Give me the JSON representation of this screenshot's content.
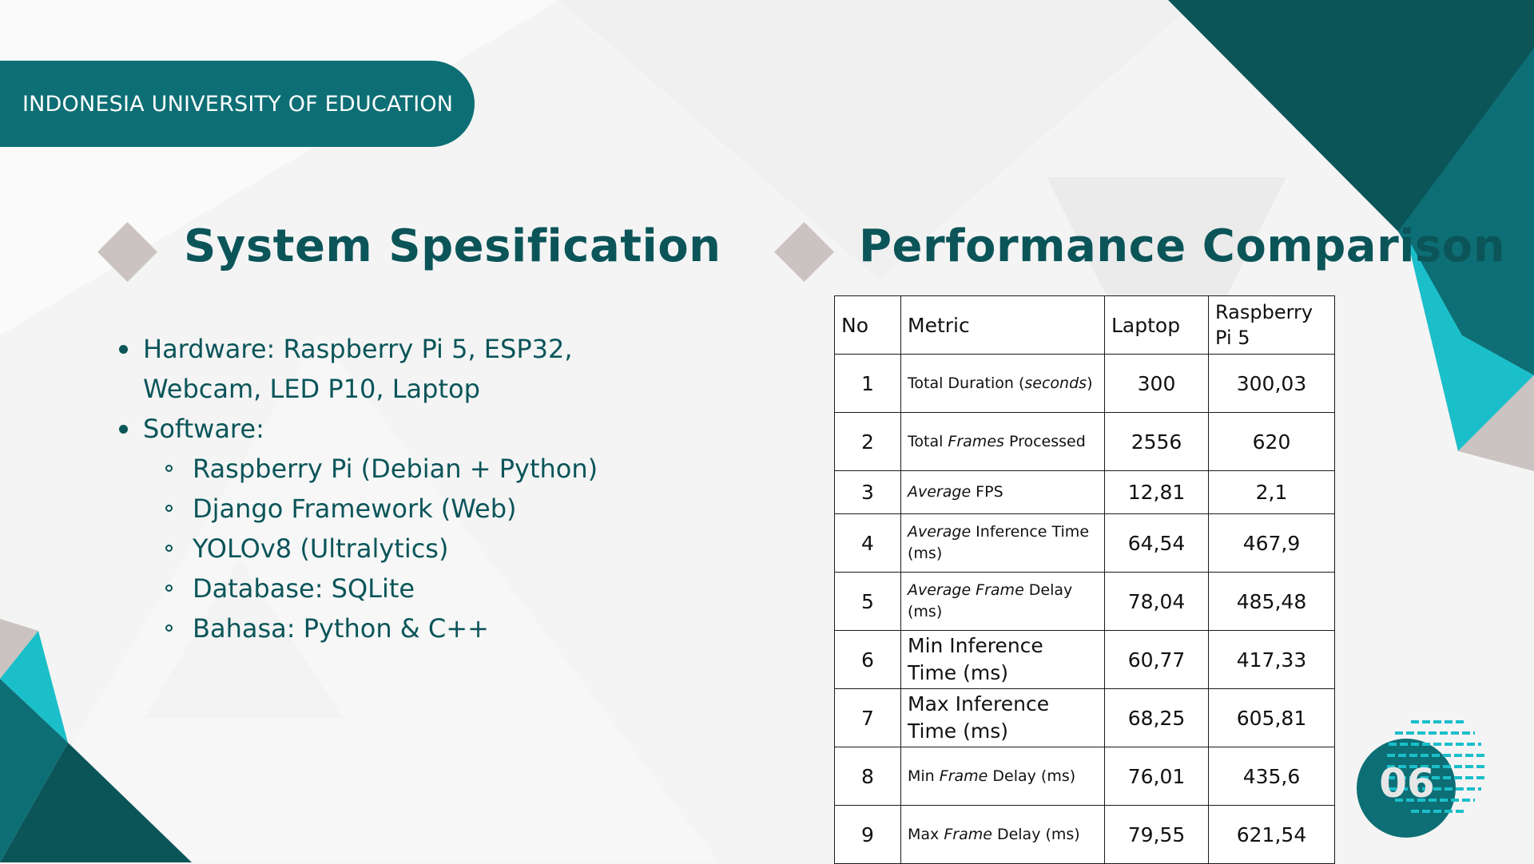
{
  "header": {
    "university": "INDONESIA UNIVERSITY OF EDUCATION"
  },
  "specification": {
    "title": "System Spesification",
    "hardware": "Hardware: Raspberry Pi 5, ESP32, Webcam, LED P10, Laptop",
    "software_label": "Software:",
    "software_items": [
      "Raspberry Pi (Debian + Python)",
      "Django Framework (Web)",
      "YOLOv8 (Ultralytics)",
      "Database: SQLite",
      "Bahasa: Python & C++"
    ]
  },
  "performance": {
    "title": "Performance Comparison",
    "columns": [
      "No",
      "Metric",
      "Laptop",
      "Raspberry Pi 5"
    ],
    "rows": [
      {
        "no": "1",
        "metric": "Total Duration (<i>seconds</i>)",
        "laptop": "300",
        "pi": "300,03",
        "large": false
      },
      {
        "no": "2",
        "metric": "Total <i>Frames</i> Processed",
        "laptop": "2556",
        "pi": "620",
        "large": false
      },
      {
        "no": "3",
        "metric": "<i>Average</i> FPS",
        "laptop": "12,81",
        "pi": "2,1",
        "large": false
      },
      {
        "no": "4",
        "metric": "<i>Average</i> Inference Time (ms)",
        "laptop": "64,54",
        "pi": "467,9",
        "large": false
      },
      {
        "no": "5",
        "metric": "<i>Average Frame</i> Delay (ms)",
        "laptop": "78,04",
        "pi": "485,48",
        "large": false
      },
      {
        "no": "6",
        "metric": "Min Inference Time (ms)",
        "laptop": "60,77",
        "pi": "417,33",
        "large": true
      },
      {
        "no": "7",
        "metric": "Max Inference Time (ms)",
        "laptop": "68,25",
        "pi": "605,81",
        "large": true
      },
      {
        "no": "8",
        "metric": "Min <i>Frame</i> Delay (ms)",
        "laptop": "76,01",
        "pi": "435,6",
        "large": false
      },
      {
        "no": "9",
        "metric": "Max <i>Frame</i> Delay (ms)",
        "laptop": "79,55",
        "pi": "621,54",
        "large": false
      }
    ]
  },
  "page_number": "06",
  "colors": {
    "teal_dark": "#0b5559",
    "teal": "#0d6f75",
    "cyan": "#1bbfca",
    "diamond": "#cbc3c2"
  }
}
